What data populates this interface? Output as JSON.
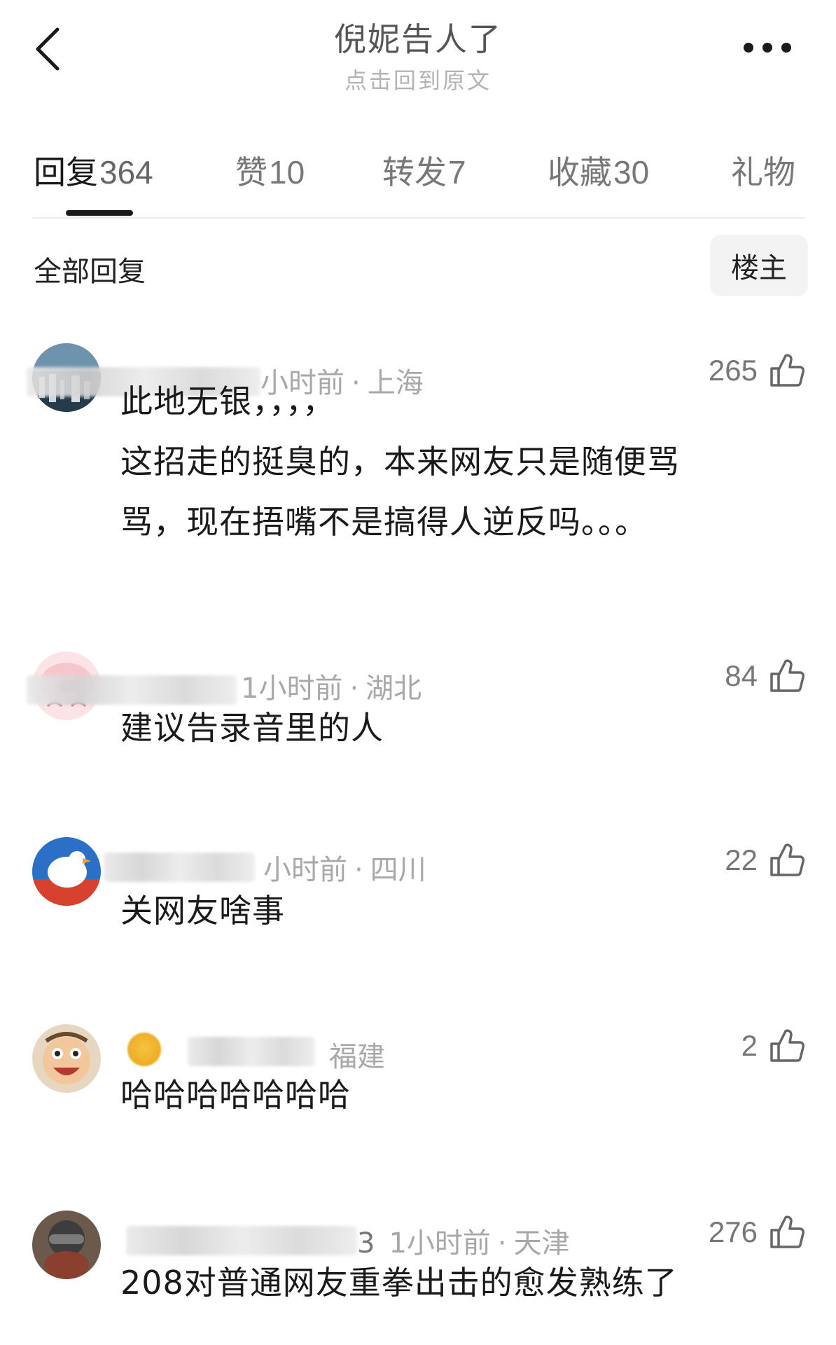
{
  "header": {
    "title": "倪妮告人了",
    "subtitle": "点击回到原文",
    "back_icon": "chevron-left-icon",
    "more_icon": "more-dots-icon"
  },
  "tabs": [
    {
      "label": "回复",
      "count": "364",
      "active": true
    },
    {
      "label": "赞",
      "count": "10",
      "active": false
    },
    {
      "label": "转发",
      "count": "7",
      "active": false
    },
    {
      "label": "收藏",
      "count": "30",
      "active": false
    },
    {
      "label": "礼物",
      "count": "",
      "active": false
    }
  ],
  "filter": {
    "label": "全部回复",
    "owner_button": "楼主"
  },
  "comments": [
    {
      "time": "小时前",
      "location": "上海",
      "likes": "265",
      "text": "此地无银，，，，\n这招走的挺臭的，本来网友只是随便骂\n骂，现在捂嘴不是搞得人逆反吗。。。"
    },
    {
      "time": "1小时前",
      "location": "湖北",
      "likes": "84",
      "text": "建议告录音里的人"
    },
    {
      "time": "小时前",
      "location": "四川",
      "likes": "22",
      "text": "关网友啥事"
    },
    {
      "time": "",
      "location": "福建",
      "likes": "2",
      "text": "哈哈哈哈哈哈哈"
    },
    {
      "username_tail": "3",
      "time": "1小时前",
      "location": "天津",
      "likes": "276",
      "text": "208对普通网友重拳出击的愈发熟练了"
    }
  ],
  "colors": {
    "text_primary": "#1a1a1a",
    "text_secondary": "#a8a8a8",
    "tab_inactive": "#777777",
    "owner_button_bg": "#f3f3f3"
  },
  "icons": {
    "like": "thumbs-up-icon"
  }
}
